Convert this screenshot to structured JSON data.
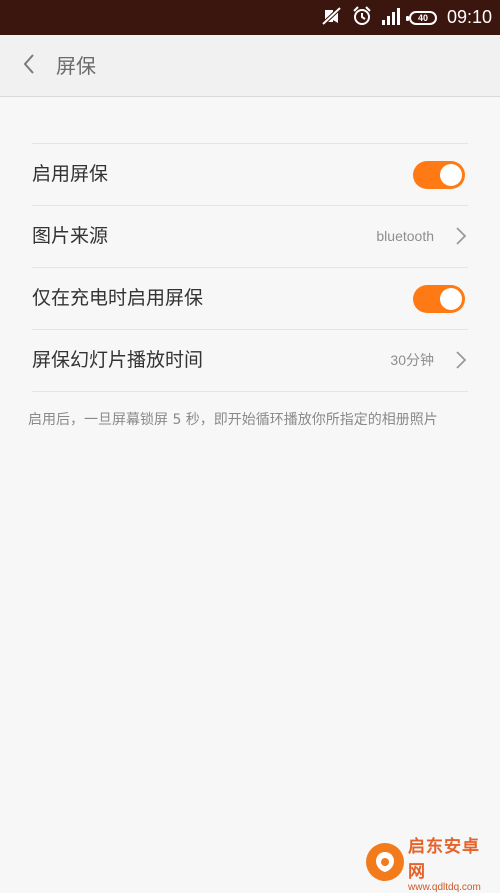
{
  "status_bar": {
    "time": "09:10",
    "battery": "40",
    "icons": [
      "mute-icon",
      "alarm-icon",
      "signal-icon",
      "battery-icon"
    ]
  },
  "header": {
    "title": "屏保",
    "back_icon": "chevron-left-icon"
  },
  "settings": [
    {
      "label": "启用屏保",
      "type": "toggle",
      "checked": true
    },
    {
      "label": "图片来源",
      "type": "value",
      "value": "bluetooth"
    },
    {
      "label": "仅在充电时启用屏保",
      "type": "toggle",
      "checked": true
    },
    {
      "label": "屏保幻灯片播放时间",
      "type": "value",
      "value": "30分钟"
    }
  ],
  "hint": "启用后，一旦屏幕锁屏 5 秒，即开始循环播放你所指定的相册照片",
  "watermark": {
    "title": "启东安卓网",
    "url": "www.qdltdq.com"
  },
  "colors": {
    "accent": "#ff7a14",
    "status_bar_bg": "#3a160f",
    "page_bg": "#f7f7f7"
  }
}
